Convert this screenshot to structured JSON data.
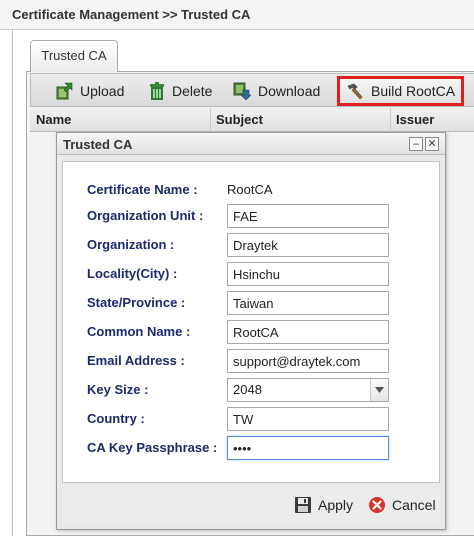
{
  "page": {
    "title": "Certificate Management >> Trusted CA"
  },
  "tabs": [
    {
      "label": "Trusted CA"
    }
  ],
  "toolbar": {
    "upload": "Upload",
    "delete": "Delete",
    "download": "Download",
    "build_rootca": "Build RootCA",
    "highlight_color": "#e01e1e"
  },
  "grid": {
    "columns": [
      "Name",
      "Subject",
      "Issuer"
    ]
  },
  "dialog": {
    "title": "Trusted CA",
    "fields": {
      "certificate_name": {
        "label": "Certificate Name :",
        "value": "RootCA"
      },
      "organization_unit": {
        "label": "Organization Unit :",
        "value": "FAE"
      },
      "organization": {
        "label": "Organization :",
        "value": "Draytek"
      },
      "locality": {
        "label": "Locality(City) :",
        "value": "Hsinchu"
      },
      "state": {
        "label": "State/Province :",
        "value": "Taiwan"
      },
      "common_name": {
        "label": "Common Name :",
        "value": "RootCA"
      },
      "email": {
        "label": "Email Address :",
        "value": "support@draytek.com"
      },
      "key_size": {
        "label": "Key Size :",
        "value": "2048"
      },
      "country": {
        "label": "Country :",
        "value": "TW"
      },
      "passphrase": {
        "label": "CA Key Passphrase :",
        "value": "••••"
      }
    },
    "apply": "Apply",
    "cancel": "Cancel",
    "label_color": "#1a2a6a"
  }
}
